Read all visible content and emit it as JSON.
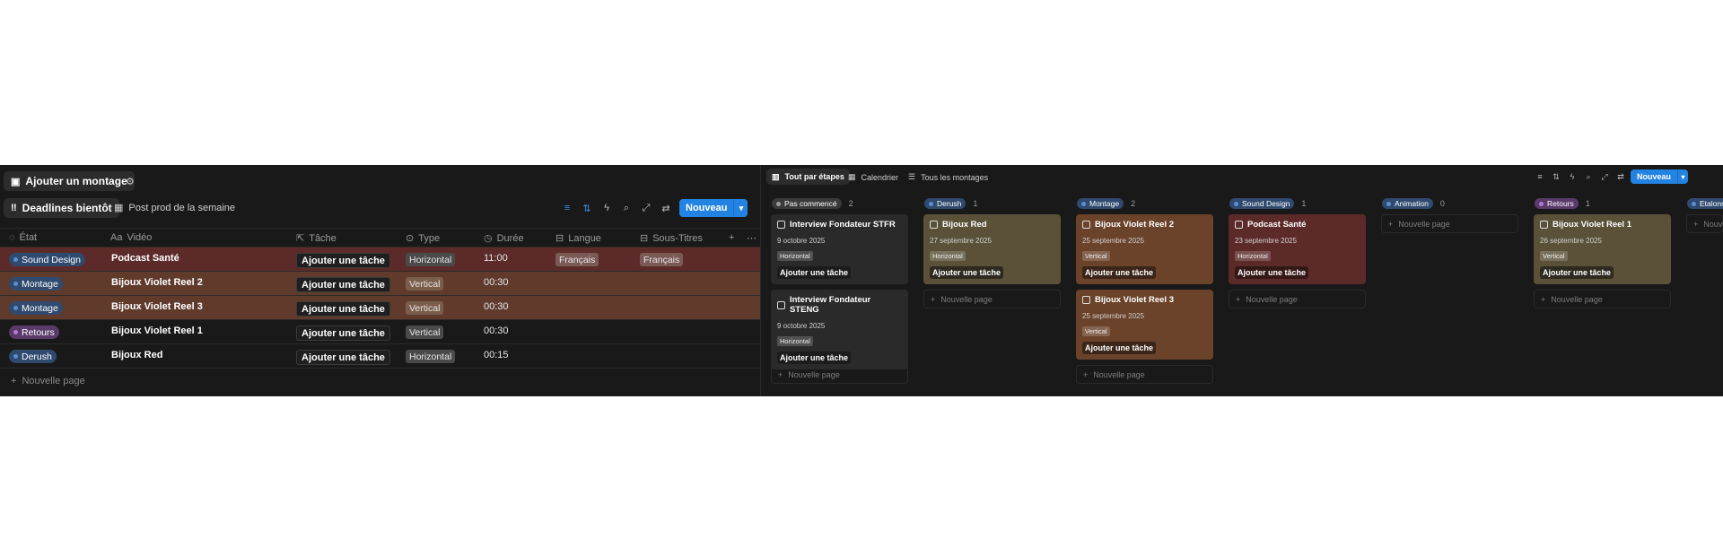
{
  "left": {
    "add_button": "Ajouter un montage",
    "views": [
      "Deadlines bientôt",
      "Post prod de la semaine"
    ],
    "new_button": "Nouveau",
    "columns": [
      "État",
      "Vidéo",
      "Tâche",
      "Type",
      "Durée",
      "Langue",
      "Sous-Titres"
    ],
    "rows": [
      {
        "state": "Sound Design",
        "video": "Podcast Santé",
        "task": "Ajouter une tâche",
        "type": "Horizontal",
        "duration": "11:00",
        "language": "Français",
        "subtitles": "Français"
      },
      {
        "state": "Montage",
        "video": "Bijoux Violet Reel 2",
        "task": "Ajouter une tâche",
        "type": "Vertical",
        "duration": "00:30",
        "language": "",
        "subtitles": ""
      },
      {
        "state": "Montage",
        "video": "Bijoux Violet Reel 3",
        "task": "Ajouter une tâche",
        "type": "Vertical",
        "duration": "00:30",
        "language": "",
        "subtitles": ""
      },
      {
        "state": "Retours",
        "video": "Bijoux Violet Reel 1",
        "task": "Ajouter une tâche",
        "type": "Vertical",
        "duration": "00:30",
        "language": "",
        "subtitles": ""
      },
      {
        "state": "Derush",
        "video": "Bijoux Red",
        "task": "Ajouter une tâche",
        "type": "Horizontal",
        "duration": "00:15",
        "language": "",
        "subtitles": ""
      }
    ],
    "new_page": "Nouvelle page"
  },
  "right": {
    "views": [
      "Tout par étapes",
      "Calendrier",
      "Tous les montages"
    ],
    "new_button": "Nouveau",
    "columns": [
      {
        "name": "Pas commencé",
        "count": "2"
      },
      {
        "name": "Derush",
        "count": "1"
      },
      {
        "name": "Montage",
        "count": "2"
      },
      {
        "name": "Sound Design",
        "count": "1"
      },
      {
        "name": "Animation",
        "count": "0"
      },
      {
        "name": "Retours",
        "count": "1"
      },
      {
        "name": "Etalonn",
        "count": ""
      }
    ],
    "cards": [
      {
        "title": "Interview Fondateur STFR",
        "date": "9 octobre 2025",
        "tag": "Horizontal",
        "button": "Ajouter une tâche"
      },
      {
        "title": "Interview Fondateur STENG",
        "date": "9 octobre 2025",
        "tag": "Horizontal",
        "button": "Ajouter une tâche"
      },
      {
        "title": "Bijoux Red",
        "date": "27 septembre 2025",
        "tag": "Horizontal",
        "button": "Ajouter une tâche"
      },
      {
        "title": "Bijoux Violet Reel 2",
        "date": "25 septembre 2025",
        "tag": "Vertical",
        "button": "Ajouter une tâche"
      },
      {
        "title": "Bijoux Violet Reel 3",
        "date": "25 septembre 2025",
        "tag": "Vertical",
        "button": "Ajouter une tâche"
      },
      {
        "title": "Podcast Santé",
        "date": "23 septembre 2025",
        "tag": "Horizontal",
        "button": "Ajouter une tâche"
      },
      {
        "title": "Bijoux Violet Reel 1",
        "date": "26 septembre 2025",
        "tag": "Vertical",
        "button": "Ajouter une tâche"
      }
    ],
    "new_page": "Nouvelle page"
  },
  "colors": {
    "background": "#191919",
    "accent": "#2383e2",
    "row_red": "#5c2b29",
    "row_brown": "#603b2c",
    "card_gray": "#2a2a2a",
    "card_olive": "#5a5138",
    "card_brown": "#6b432a",
    "card_red": "#5c2b29"
  }
}
